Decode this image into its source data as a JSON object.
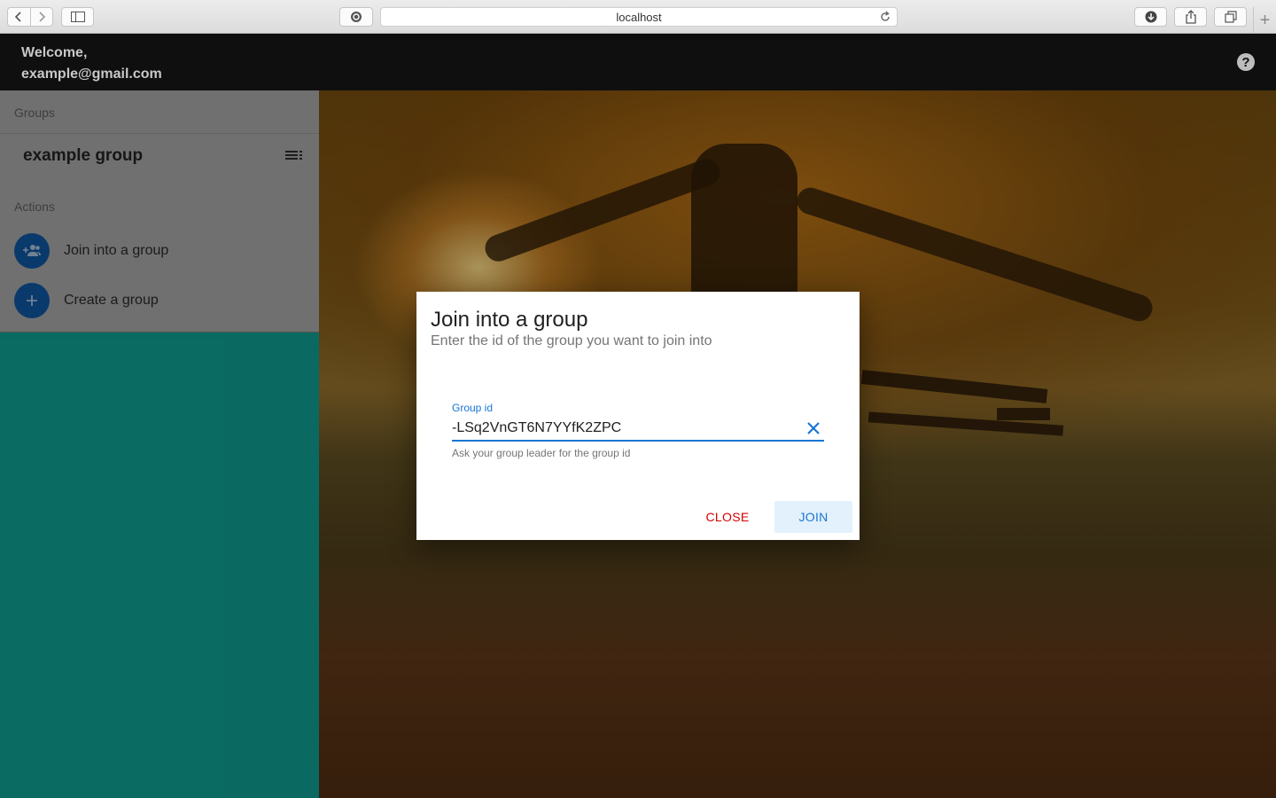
{
  "browser": {
    "url": "localhost",
    "new_tab": "+"
  },
  "header": {
    "welcome_line1": "Welcome,",
    "welcome_line2": "example@gmail.com",
    "help": "?"
  },
  "sidebar": {
    "groups_header": "Groups",
    "groups": [
      {
        "name": "example group"
      }
    ],
    "actions_header": "Actions",
    "actions": [
      {
        "label": "Join into a group",
        "icon": "group-add-icon"
      },
      {
        "label": "Create a group",
        "icon": "plus-icon"
      }
    ]
  },
  "dialog": {
    "title": "Join into a group",
    "subtitle": "Enter the id of the group you want to join into",
    "field_label": "Group id",
    "field_value": "-LSq2VnGT6N7YYfK2ZPC",
    "field_hint": "Ask your group leader for the group id",
    "close_label": "CLOSE",
    "join_label": "JOIN"
  },
  "colors": {
    "accent": "#1976d2",
    "danger": "#d50000",
    "sidebar_bg": "#0e9488",
    "avatar_bg": "#0e5196"
  }
}
